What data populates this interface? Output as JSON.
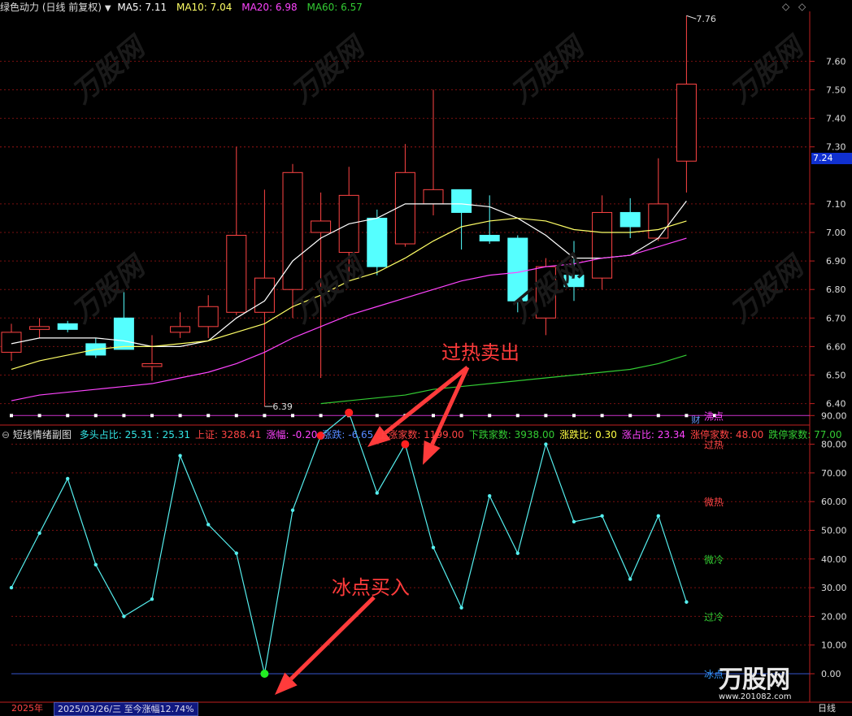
{
  "header": {
    "title": "绿色动力 (日线 前复权)",
    "ma5": "MA5: 7.11",
    "ma10": "MA10: 7.04",
    "ma20": "MA20: 6.98",
    "ma60": "MA60: 6.57",
    "ma_colors": {
      "ma5": "#ffffff",
      "ma10": "#ffff66",
      "ma20": "#ff44ff",
      "ma60": "#33cc33"
    }
  },
  "price_panel": {
    "high_label": "7.76",
    "low_label": "6.39",
    "current_price": "7.24",
    "finance_marker": "财",
    "y_ticks": [
      "7.60",
      "7.50",
      "7.40",
      "7.30",
      "7.10",
      "7.00",
      "6.90",
      "6.80",
      "6.70",
      "6.60",
      "6.50",
      "6.40"
    ]
  },
  "sub_panel": {
    "title": "短线情绪副图",
    "stats": [
      {
        "label": "多头占比: 25.31 : 25.31",
        "color": "#33e6e6"
      },
      {
        "label": "上证: 3288.41",
        "color": "#ff4444"
      },
      {
        "label": "涨幅: -0.20",
        "color": "#ff44ff"
      },
      {
        "label": "涨跌: -6.65",
        "color": "#5588ff"
      },
      {
        "label": "上涨家数: 1199.00",
        "color": "#ff4444"
      },
      {
        "label": "下跌家数: 3938.00",
        "color": "#33cc33"
      },
      {
        "label": "涨跌比: 0.30",
        "color": "#ffff44"
      },
      {
        "label": "涨占比: 23.34",
        "color": "#ff44ff"
      },
      {
        "label": "涨停家数: 48.00",
        "color": "#ff4444"
      },
      {
        "label": "跌停家数: 77.00",
        "color": "#33cc33"
      }
    ],
    "y_ticks": [
      "90.00",
      "80.00",
      "70.00",
      "60.00",
      "50.00",
      "40.00",
      "30.00",
      "20.00",
      "10.00",
      "0.00"
    ],
    "zone_labels": [
      {
        "text": "沸点",
        "value": 90,
        "color": "#ff44ff"
      },
      {
        "text": "过热",
        "value": 80,
        "color": "#ff4444"
      },
      {
        "text": "微热",
        "value": 60,
        "color": "#ff4444"
      },
      {
        "text": "微冷",
        "value": 40,
        "color": "#33cc33"
      },
      {
        "text": "过冷",
        "value": 20,
        "color": "#33cc33"
      },
      {
        "text": "冰点",
        "value": 0,
        "color": "#3399ff"
      }
    ]
  },
  "annotations": {
    "sell": "过热卖出",
    "buy": "冰点买入"
  },
  "status_bar": {
    "year": "2025年",
    "date_info": "2025/03/26/三  至今涨幅12.74%",
    "period": "日线"
  },
  "watermark": {
    "text": "万股网",
    "site": "www.201082.com"
  },
  "chart_data": {
    "type": "candlestick",
    "candles": [
      {
        "o": 6.58,
        "h": 6.68,
        "l": 6.55,
        "c": 6.65
      },
      {
        "o": 6.66,
        "h": 6.7,
        "l": 6.63,
        "c": 6.67
      },
      {
        "o": 6.68,
        "h": 6.69,
        "l": 6.65,
        "c": 6.66
      },
      {
        "o": 6.61,
        "h": 6.63,
        "l": 6.56,
        "c": 6.57
      },
      {
        "o": 6.7,
        "h": 6.8,
        "l": 6.59,
        "c": 6.59
      },
      {
        "o": 6.53,
        "h": 6.64,
        "l": 6.48,
        "c": 6.54
      },
      {
        "o": 6.65,
        "h": 6.72,
        "l": 6.63,
        "c": 6.67
      },
      {
        "o": 6.67,
        "h": 6.78,
        "l": 6.63,
        "c": 6.74
      },
      {
        "o": 6.72,
        "h": 7.3,
        "l": 6.71,
        "c": 6.99
      },
      {
        "o": 6.72,
        "h": 7.15,
        "l": 6.39,
        "c": 6.84
      },
      {
        "o": 6.8,
        "h": 7.24,
        "l": 6.7,
        "c": 7.21
      },
      {
        "o": 7.0,
        "h": 7.14,
        "l": 6.49,
        "c": 7.04
      },
      {
        "o": 6.93,
        "h": 7.23,
        "l": 6.83,
        "c": 7.13
      },
      {
        "o": 7.05,
        "h": 7.08,
        "l": 6.85,
        "c": 6.88
      },
      {
        "o": 6.96,
        "h": 7.31,
        "l": 6.95,
        "c": 7.21
      },
      {
        "o": 7.1,
        "h": 7.5,
        "l": 7.06,
        "c": 7.15
      },
      {
        "o": 7.15,
        "h": 7.15,
        "l": 6.94,
        "c": 7.07
      },
      {
        "o": 6.99,
        "h": 7.13,
        "l": 6.96,
        "c": 6.97
      },
      {
        "o": 6.98,
        "h": 6.99,
        "l": 6.72,
        "c": 6.76
      },
      {
        "o": 6.7,
        "h": 6.91,
        "l": 6.64,
        "c": 6.88
      },
      {
        "o": 6.85,
        "h": 6.97,
        "l": 6.76,
        "c": 6.81
      },
      {
        "o": 6.84,
        "h": 7.13,
        "l": 6.8,
        "c": 7.07
      },
      {
        "o": 7.07,
        "h": 7.12,
        "l": 6.98,
        "c": 7.02
      },
      {
        "o": 6.98,
        "h": 7.26,
        "l": 6.97,
        "c": 7.1
      },
      {
        "o": 7.25,
        "h": 7.76,
        "l": 7.14,
        "c": 7.52
      }
    ],
    "ma5": [
      6.61,
      6.63,
      6.63,
      6.63,
      6.62,
      6.6,
      6.6,
      6.62,
      6.7,
      6.76,
      6.9,
      6.98,
      7.03,
      7.05,
      7.1,
      7.1,
      7.1,
      7.09,
      7.05,
      6.99,
      6.91,
      6.91,
      6.92,
      6.98,
      7.11
    ],
    "ma10": [
      6.52,
      6.55,
      6.57,
      6.59,
      6.6,
      6.6,
      6.61,
      6.62,
      6.65,
      6.68,
      6.74,
      6.78,
      6.83,
      6.86,
      6.91,
      6.97,
      7.02,
      7.04,
      7.05,
      7.04,
      7.01,
      7.0,
      7.0,
      7.01,
      7.04
    ],
    "ma20": [
      6.41,
      6.43,
      6.44,
      6.45,
      6.46,
      6.47,
      6.49,
      6.51,
      6.54,
      6.58,
      6.63,
      6.67,
      6.71,
      6.74,
      6.77,
      6.8,
      6.83,
      6.85,
      6.86,
      6.88,
      6.89,
      6.91,
      6.92,
      6.95,
      6.98
    ],
    "ma60_start_index": 11,
    "ma60": [
      6.4,
      6.41,
      6.42,
      6.43,
      6.45,
      6.46,
      6.47,
      6.48,
      6.49,
      6.5,
      6.51,
      6.52,
      6.54,
      6.57
    ],
    "emotion": [
      30,
      49,
      68,
      38,
      20,
      26,
      76,
      52,
      42,
      0,
      57,
      83,
      91,
      63,
      80,
      44,
      23,
      62,
      42,
      80,
      53,
      55,
      33,
      55,
      25
    ],
    "sell_points": [
      11,
      12,
      14
    ],
    "buy_points": [
      9
    ]
  }
}
